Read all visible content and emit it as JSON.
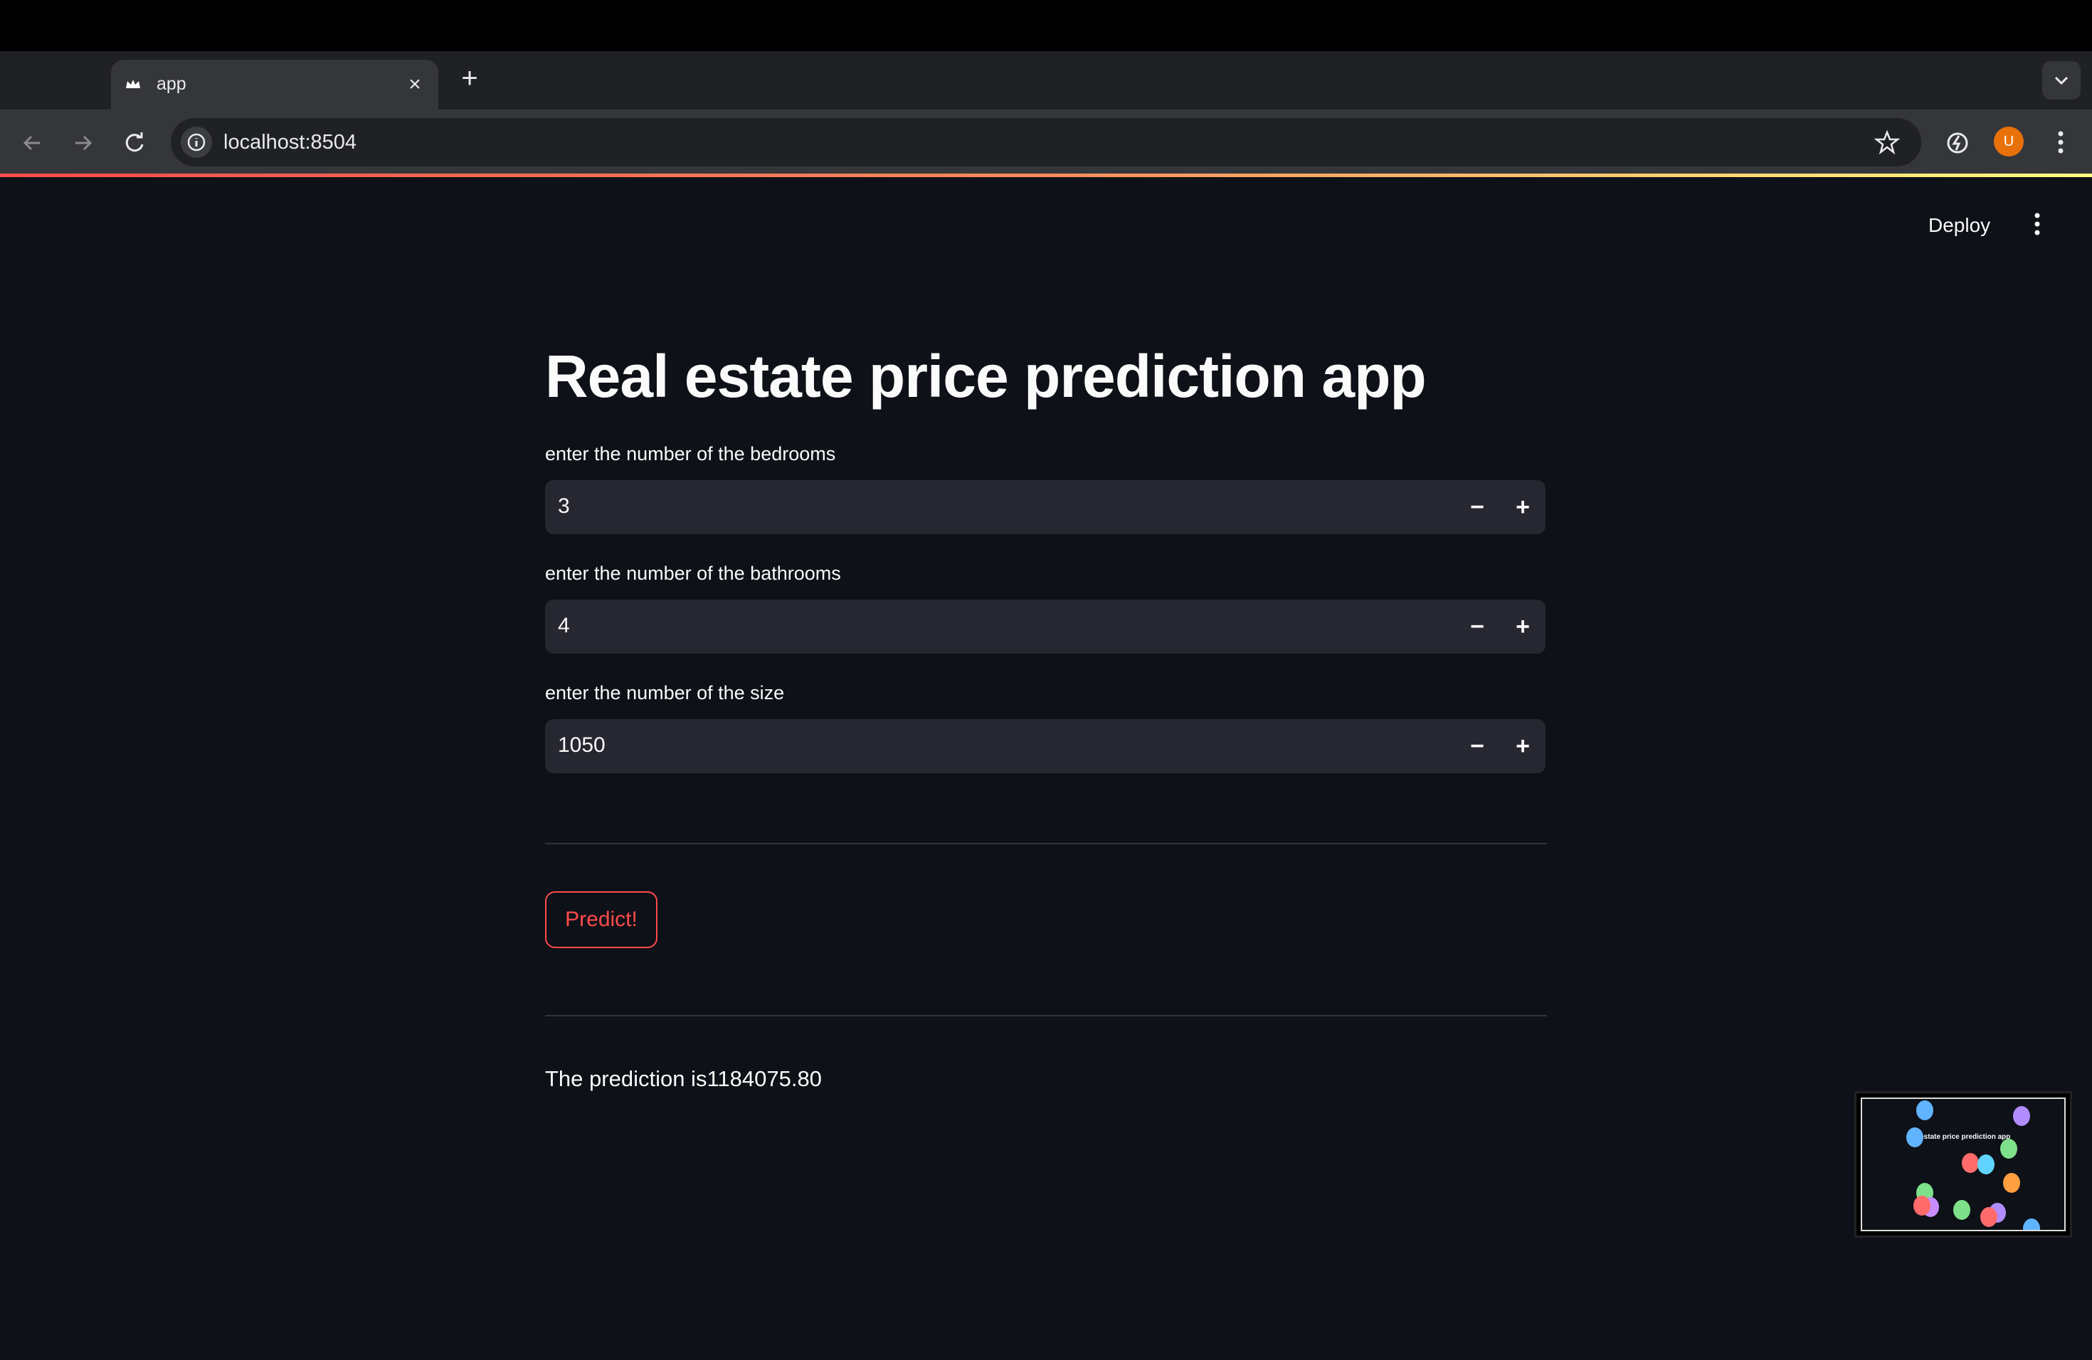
{
  "browser": {
    "tab": {
      "title": "app"
    },
    "url": "localhost:8504",
    "avatar_initial": "U"
  },
  "app": {
    "header": {
      "deploy_label": "Deploy"
    },
    "title": "Real estate price prediction app",
    "fields": [
      {
        "label": "enter the number of the bedrooms",
        "value": "3"
      },
      {
        "label": "enter the number of the bathrooms",
        "value": "4"
      },
      {
        "label": "enter the number of the size",
        "value": "1050"
      }
    ],
    "stepper": {
      "minus": "−",
      "plus": "+"
    },
    "predict_label": "Predict!",
    "result_text": "The prediction is1184075.80"
  },
  "thumbnail": {
    "title": "al estate price prediction app"
  },
  "colors": {
    "accent": "#ff4b4b",
    "app_bg": "#0e1117",
    "input_bg": "#262730",
    "avatar": "#e8710a"
  },
  "icons": [
    "streamlit-crown-icon",
    "close-icon",
    "plus-icon",
    "chevron-down-icon",
    "back-arrow-icon",
    "forward-arrow-icon",
    "reload-icon",
    "info-icon",
    "star-icon",
    "extension-icon",
    "kebab-menu-icon"
  ]
}
